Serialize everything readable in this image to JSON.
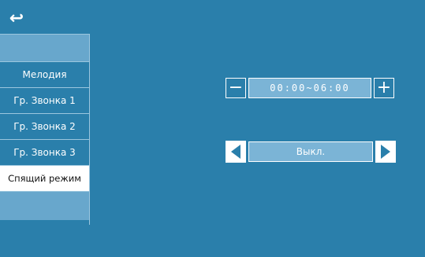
{
  "header": {
    "back_icon": "return-arrow-icon",
    "back_glyph": "↩"
  },
  "sidebar": {
    "items": [
      {
        "label": "Мелодия"
      },
      {
        "label": "Гр. Звонка 1"
      },
      {
        "label": "Гр. Звонка 2"
      },
      {
        "label": "Гр. Звонка 3"
      },
      {
        "label": "Спящий режим",
        "active": true
      }
    ]
  },
  "time_range": {
    "minus_glyph": "−",
    "plus_glyph": "+",
    "value": "00:00~06:00"
  },
  "mode": {
    "value": "Выкл."
  },
  "colors": {
    "background": "#2a7fab",
    "field": "#7bb4d6",
    "highlight": "#ffffff"
  }
}
